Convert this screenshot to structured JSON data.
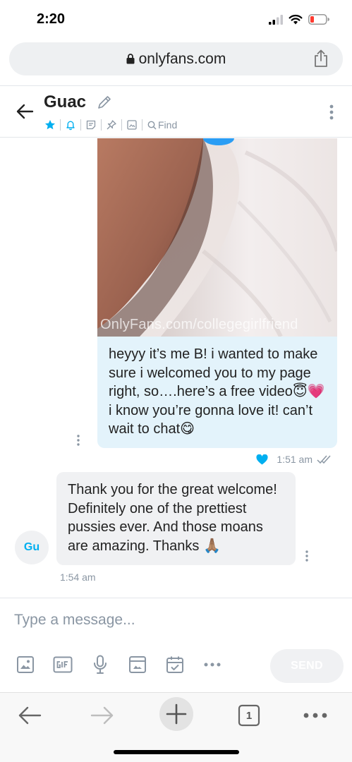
{
  "status_bar": {
    "time": "2:20"
  },
  "browser": {
    "url": "onlyfans.com",
    "tab_count": "1"
  },
  "chat": {
    "contact_name": "Guac",
    "find_label": "Find"
  },
  "messages": {
    "outgoing": {
      "watermark": "OnlyFans.com/collegegirlfriend",
      "text": "heyyy it’s me B! i wanted to make sure i welcomed you to my page right, so….here’s a free video😇💗 i know you’re gonna love it! can’t wait to chat😋",
      "time": "1:51 am"
    },
    "incoming": {
      "avatar_initials": "Gu",
      "text": "Thank you for the great wel­come! Definitely one of the pret­tiest pussies ever. And those moans are amazing. Thanks 🙏🏽",
      "time": "1:54 am"
    }
  },
  "composer": {
    "placeholder": "Type a message...",
    "send_label": "SEND"
  },
  "colors": {
    "accent": "#00aff0",
    "outgoing_bubble": "#e3f3fb",
    "incoming_bubble": "#f0f1f3",
    "muted": "#8a96a3"
  }
}
